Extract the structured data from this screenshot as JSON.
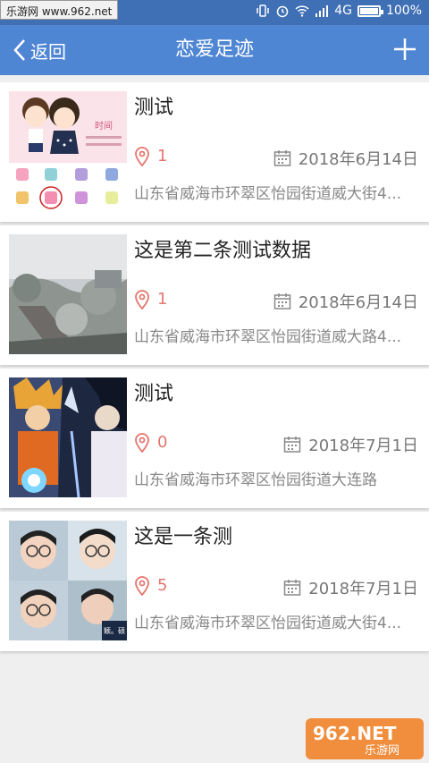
{
  "status_bar": {
    "watermark": "乐游网 www.962.net",
    "network": "4G",
    "battery": "100%",
    "battery_level": 1.0
  },
  "nav": {
    "back_label": "返回",
    "title": "恋爱足迹",
    "add_icon": "plus-icon"
  },
  "cards": [
    {
      "title": "测试",
      "count": "1",
      "date": "2018年6月14日",
      "address": "山东省威海市环翠区怡园街道威大街4..."
    },
    {
      "title": "这是第二条测试数据",
      "count": "1",
      "date": "2018年6月14日",
      "address": "山东省威海市环翠区怡园街道威大路4..."
    },
    {
      "title": "测试",
      "count": "0",
      "date": "2018年7月1日",
      "address": "山东省威海市环翠区怡园街道大连路"
    },
    {
      "title": "这是一条测",
      "count": "5",
      "date": "2018年7月1日",
      "address": "山东省威海市环翠区怡园街道威大街4..."
    }
  ],
  "thumb_texts": {
    "card1_caption": "时间",
    "card4_caption": "颖。硕"
  },
  "watermark_logo": {
    "text1": "962.NET",
    "text2": "乐游网"
  },
  "colors": {
    "navbar": "#4f86d4",
    "statusbar": "#3f6fb4",
    "accent": "#e5756e"
  }
}
